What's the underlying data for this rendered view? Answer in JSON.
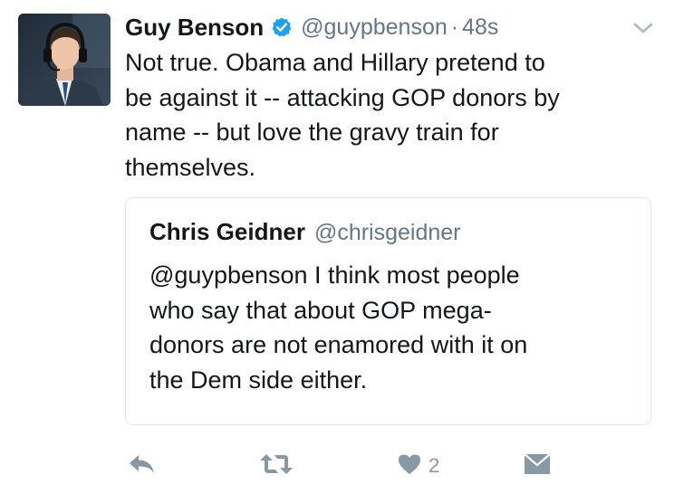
{
  "tweet": {
    "author": {
      "display_name": "Guy Benson",
      "handle": "@guypbenson",
      "verified": true,
      "avatar_icon": "profile-photo"
    },
    "separator": "·",
    "timestamp": "48s",
    "text": "Not true. Obama and Hillary pretend to\nbe against it -- attacking GOP donors by\nname -- but love the gravy train for\nthemselves.",
    "menu_icon": "chevron-down-icon",
    "quoted": {
      "display_name": "Chris Geidner",
      "handle": "@chrisgeidner",
      "text": "@guypbenson I think most people\nwho say that about GOP mega-\ndonors are not enamored with it on\nthe Dem side either."
    },
    "actions": {
      "reply_icon": "reply-icon",
      "retweet_icon": "retweet-icon",
      "like_icon": "heart-icon",
      "like_count": "2",
      "dm_icon": "envelope-icon"
    }
  },
  "colors": {
    "text": "#14171a",
    "secondary": "#657786",
    "verified_blue": "#1da1f2",
    "action_gray": "#8899a6",
    "border": "#e1e8ed"
  }
}
